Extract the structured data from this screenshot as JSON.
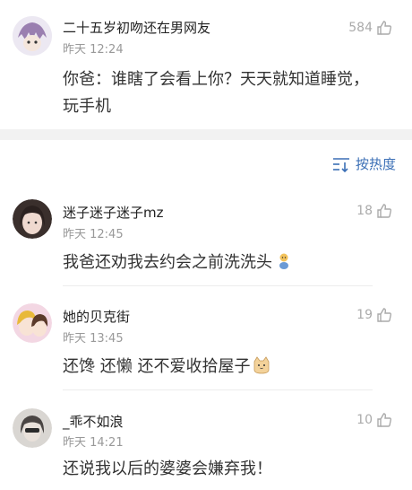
{
  "top_comment": {
    "username": "二十五岁初吻还在男网友",
    "time": "昨天 12:24",
    "likes": "584",
    "text": "你爸：谁瞎了会看上你？天天就知道睡觉，玩手机"
  },
  "sort": {
    "label": "按热度"
  },
  "replies": [
    {
      "username": "迷子迷子迷子mz",
      "time": "昨天 12:45",
      "likes": "18",
      "text": "我爸还劝我去约会之前洗洗头"
    },
    {
      "username": "她的贝克街",
      "time": "昨天 13:45",
      "likes": "19",
      "text": "还馋 还懒 还不爱收拾屋子"
    },
    {
      "username": "_乖不如浪",
      "time": "昨天 14:21",
      "likes": "10",
      "text": "还说我以后的婆婆会嫌弃我！"
    }
  ],
  "colors": {
    "accent": "#3b6fb6",
    "muted": "#999999",
    "gap": "#f2f2f2"
  }
}
